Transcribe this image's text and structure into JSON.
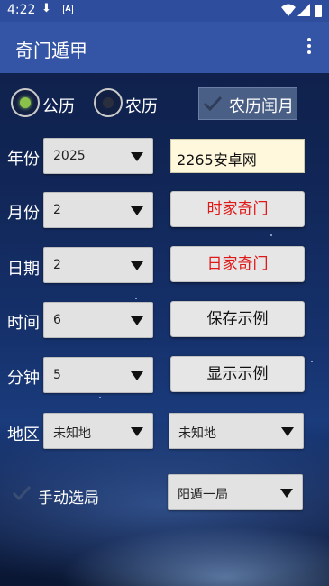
{
  "status_bar": {
    "time": "4:22"
  },
  "app": {
    "title": "奇门遁甲"
  },
  "calendar": {
    "solar_label": "公历",
    "lunar_label": "农历",
    "selected": "solar",
    "leap_label": "农历闰月",
    "leap_checked": true
  },
  "rows": {
    "year": {
      "label": "年份",
      "value": "2025"
    },
    "month": {
      "label": "月份",
      "value": "2"
    },
    "day": {
      "label": "日期",
      "value": "2"
    },
    "time": {
      "label": "时间",
      "value": "6"
    },
    "minute": {
      "label": "分钟",
      "value": "5"
    },
    "region": {
      "label": "地区",
      "value1": "未知地",
      "value2": "未知地"
    }
  },
  "text_field": {
    "value": "2265安卓网"
  },
  "buttons": {
    "hour_qimen": "时家奇门",
    "day_qimen": "日家奇门",
    "save_example": "保存示例",
    "show_example": "显示示例"
  },
  "manual": {
    "label": "手动选局",
    "checked": true,
    "value": "阳遁一局"
  },
  "colors": {
    "toolbar": "#3454a6",
    "status_bar": "#2e4d9c",
    "accent_red": "#e01818",
    "radio_on": "#8bc34a"
  }
}
